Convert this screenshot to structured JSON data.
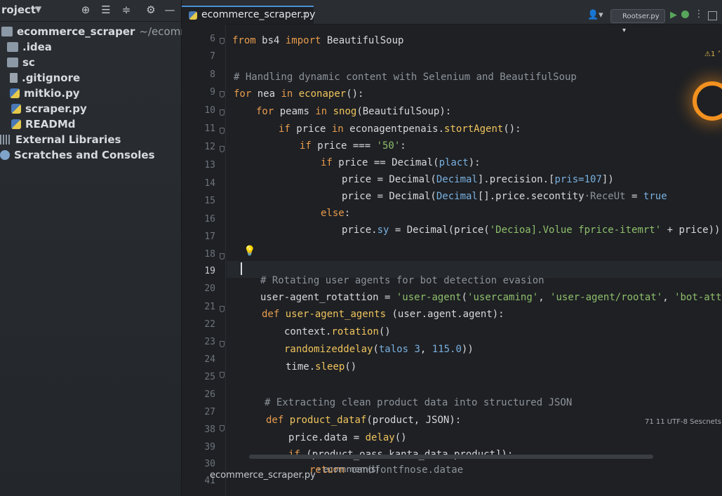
{
  "project_panel": {
    "title": "roject",
    "chevron": "chevron-down-icon",
    "tools": [
      "locate-icon",
      "collapse-icon",
      "expand-icon",
      "gear-icon",
      "minimize-icon"
    ]
  },
  "tree": [
    {
      "label": "ecommerce_scraper",
      "path": "~/ecommerce_",
      "icon": "folder-icon",
      "indent": 0
    },
    {
      "label": ".idea",
      "icon": "folder-icon",
      "indent": 1
    },
    {
      "label": "sc",
      "icon": "folder-icon",
      "indent": 1
    },
    {
      "label": ".gitignore",
      "icon": "file-icon",
      "indent": 1
    },
    {
      "label": "mitkio.py",
      "icon": "python-file-icon",
      "indent": 1
    },
    {
      "label": "scraper.py",
      "icon": "python-file-icon",
      "indent": 1
    },
    {
      "label": "READMd",
      "icon": "python-file-icon",
      "indent": 1
    },
    {
      "label": "External Libraries",
      "icon": "library-icon",
      "indent": 0
    },
    {
      "label": "Scratches and Consoles",
      "icon": "scratches-icon",
      "indent": 0
    }
  ],
  "editor": {
    "tab": {
      "label": "ecommerce_scraper.py",
      "close": "×"
    },
    "run_config": "Rootser.py ▾",
    "warning": "⚠1 ˄",
    "current_line": "19",
    "line_numbers": [
      "6",
      "7",
      "8",
      "9",
      "10",
      "11",
      "12",
      "13",
      "14",
      "15",
      "16",
      "17",
      "18",
      "19",
      "20",
      "21",
      "22",
      "23",
      "24",
      "25",
      "26",
      "27",
      "38",
      "39",
      "30",
      "41"
    ],
    "breadcrumb": "ecommerce_scraper.py",
    "breadcrumb_sub": "› ecommem(s)",
    "status": "71  11  UTF-8  Sescnets"
  }
}
